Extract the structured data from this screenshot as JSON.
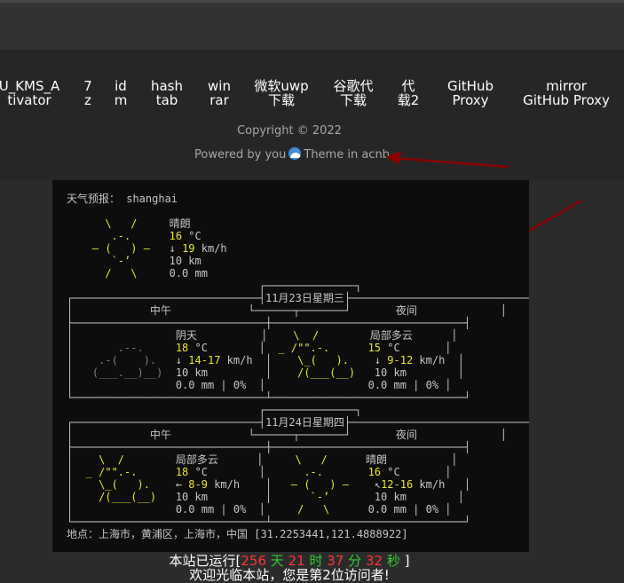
{
  "nav": {
    "items": [
      {
        "label": "U_KMS_A\ntivator"
      },
      {
        "label": "7\nz"
      },
      {
        "label": "id\nm"
      },
      {
        "label": "hash\ntab"
      },
      {
        "label": "win\nrar"
      },
      {
        "label": "微软uwp\n下载"
      },
      {
        "label": "谷歌代\n下载"
      },
      {
        "label": "代\n载2"
      },
      {
        "label": "GitHub\nProxy"
      },
      {
        "label": "mirror\nGitHub Proxy"
      }
    ]
  },
  "footer": {
    "copyright": "Copyright © 2022",
    "powered_prefix": "Powered by you",
    "powered_suffix": "Theme in acnb"
  },
  "weather": {
    "header": "天气预报： shanghai",
    "current": {
      "icon_lines": [
        "    \\   /    ",
        "     .-.     ",
        "  ― (   ) ―  ",
        "     `-’     ",
        "    /   \\    "
      ],
      "condition": "晴朗",
      "temp": "16",
      "temp_unit": "°C",
      "wind_dir": "↓",
      "wind": "19",
      "wind_unit": "km/h",
      "visibility": "10 km",
      "precip": "0.0 mm"
    },
    "days": [
      {
        "date": "11月23日星期三",
        "left_title": "中午",
        "right_title": "夜间",
        "left": {
          "condition": "阴天",
          "temp": "18",
          "wind_dir": "↓",
          "wind": "14-17",
          "visibility": "10 km",
          "precip": "0.0 mm | 0%"
        },
        "right": {
          "condition": "局部多云",
          "temp": "15",
          "wind_dir": "↓",
          "wind": "9-12",
          "visibility": "10 km",
          "precip": "0.0 mm | 0%"
        }
      },
      {
        "date": "11月24日星期四",
        "left_title": "中午",
        "right_title": "夜间",
        "left": {
          "condition": "局部多云",
          "temp": "18",
          "wind_dir": "←",
          "wind": "8-9",
          "visibility": "10 km",
          "precip": "0.0 mm | 0%"
        },
        "right": {
          "condition": "晴朗",
          "temp": "16",
          "wind_dir": "↖",
          "wind": "12-16",
          "visibility": "10 km",
          "precip": "0.0 mm | 0%"
        }
      }
    ],
    "location": "地点：上海市，黄浦区，上海市，中国 [31.2253441,121.4888922]"
  },
  "runtime": {
    "prefix": "本站已运行[",
    "days": "256",
    "days_label": "天",
    "hours": "21",
    "hours_label": "时",
    "minutes": "37",
    "minutes_label": "分",
    "seconds": "32",
    "seconds_label": "秒",
    "suffix": "]",
    "welcome": "欢迎光临本站，您是第2位访问者!"
  },
  "colors": {
    "accent_temp": "#e7e738",
    "runtime_red": "#ff3333",
    "runtime_green": "#33cc33",
    "arrow": "#8b0000"
  }
}
